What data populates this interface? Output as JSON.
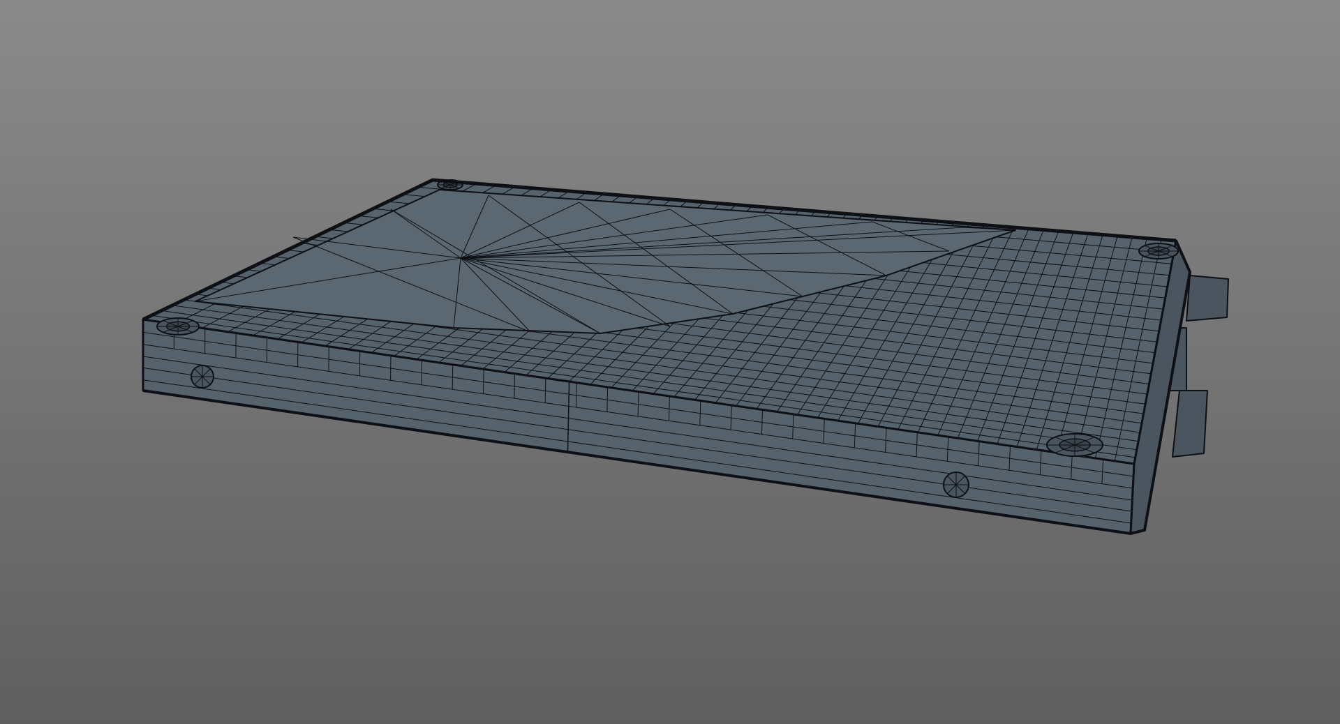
{
  "viewport": {
    "background_top": "#8a8a8a",
    "background_bottom": "#5f5f5f",
    "mesh_fill": "#56626c",
    "mesh_fill_dark": "#4a555f",
    "wire_color": "#0d1014"
  },
  "model": {
    "object": "ssd-drive-wireframe",
    "display_mode": "wireframe-on-shaded"
  }
}
